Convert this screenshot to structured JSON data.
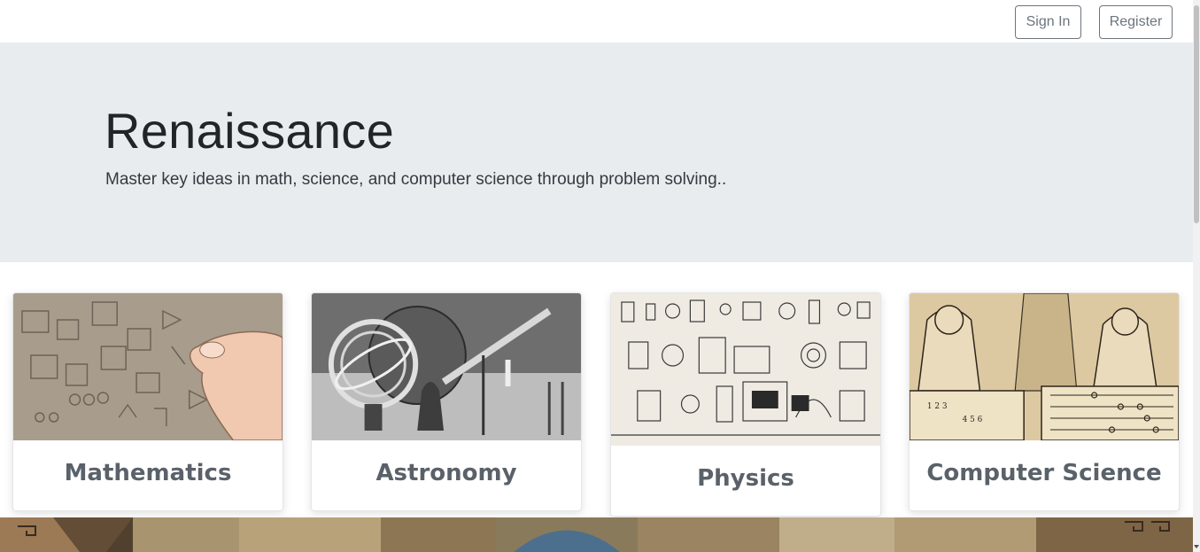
{
  "navbar": {
    "sign_in_label": "Sign In",
    "register_label": "Register"
  },
  "hero": {
    "title": "Renaissance",
    "lead": "Master key ideas in math, science, and computer science through problem solving.."
  },
  "cards": [
    {
      "title": "Mathematics",
      "image": "cuneiform-tablet-illustration"
    },
    {
      "title": "Astronomy",
      "image": "armillary-sphere-telescope-engraving"
    },
    {
      "title": "Physics",
      "image": "scientific-apparatus-plate"
    },
    {
      "title": "Computer Science",
      "image": "arithmetic-abacus-woodcut"
    }
  ],
  "colors": {
    "hero_bg": "#e9ecef",
    "button_border": "#6c757d",
    "card_title": "#5a6169"
  }
}
